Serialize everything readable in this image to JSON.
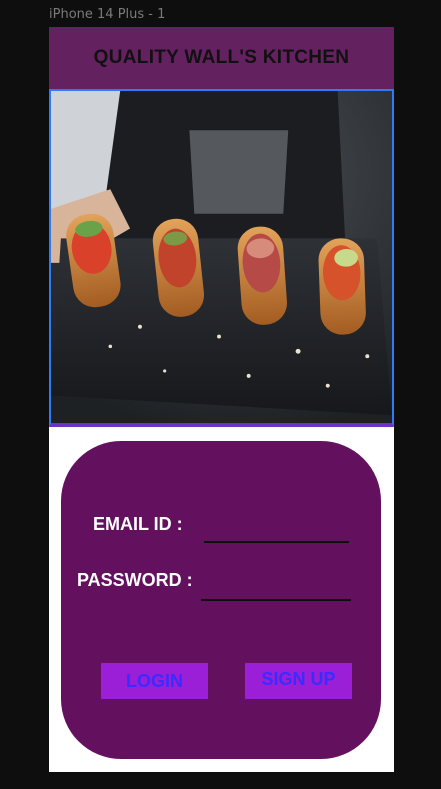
{
  "canvas": {
    "frame_label": "iPhone 14 Plus - 1"
  },
  "header": {
    "title": "QUALITY WALL'S  KITCHEN"
  },
  "hero": {
    "image": "food-platter-photo"
  },
  "login_form": {
    "email_label": "EMAIL ID :",
    "email_value": "",
    "password_label": "PASSWORD :",
    "password_value": "",
    "login_label": "LOGIN",
    "signup_label": "SIGN UP"
  },
  "colors": {
    "header_bg": "#64215f",
    "card_bg": "#63115f",
    "button_bg": "#9b1fd6",
    "button_text": "#3a2cff",
    "selection_border": "#2f7bf5"
  }
}
